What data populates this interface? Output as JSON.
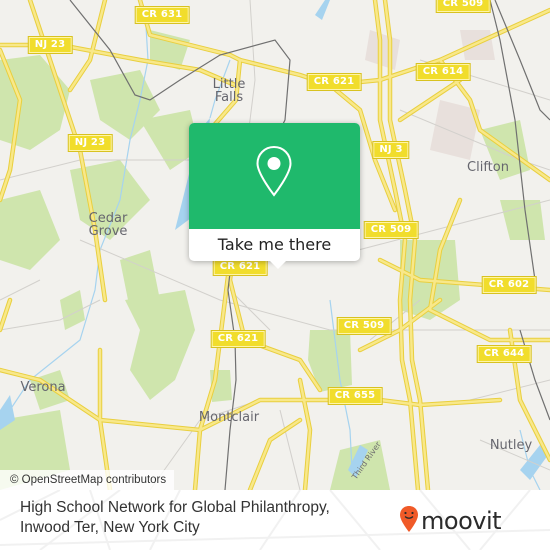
{
  "map": {
    "colors": {
      "background": "#f2f1ed",
      "road": "#f6de57",
      "park": "#cfe5ad",
      "water": "#a6d3ef",
      "rail": "#707070",
      "accent": "#1fb96c",
      "brand": "#f05a28"
    },
    "road_shields": [
      {
        "label": "CR 631"
      },
      {
        "label": "NJ 23"
      },
      {
        "label": "NJ 23"
      },
      {
        "label": "CR 509"
      },
      {
        "label": "CR 621"
      },
      {
        "label": "CR 614"
      },
      {
        "label": "NJ 3"
      },
      {
        "label": "CR 509"
      },
      {
        "label": "CR 621"
      },
      {
        "label": "CR 621"
      },
      {
        "label": "CR 602"
      },
      {
        "label": "CR 509"
      },
      {
        "label": "CR 644"
      },
      {
        "label": "CR 655"
      }
    ],
    "places": [
      {
        "label": "Little\nFalls"
      },
      {
        "label": "Cedar\nGrove"
      },
      {
        "label": "Clifton"
      },
      {
        "label": "Verona"
      },
      {
        "label": "Montclair"
      },
      {
        "label": "Nutley"
      }
    ],
    "river_label": "Third River",
    "attribution": "© OpenStreetMap contributors"
  },
  "popup": {
    "icon": "map-pin-icon",
    "button_label": "Take me there"
  },
  "footer": {
    "address_line1": "High School Network for Global Philanthropy,",
    "address_line2": "Inwood Ter, New York City",
    "logo_text": "moovit",
    "logo_icon": "moovit-pin-smile-icon"
  }
}
